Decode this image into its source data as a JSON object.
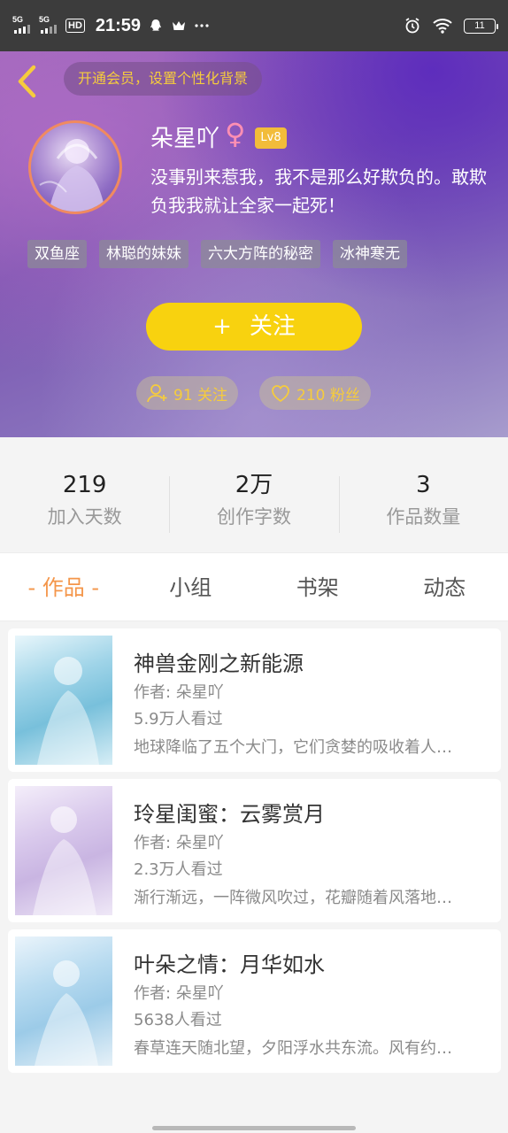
{
  "status_bar": {
    "signal1": "5G",
    "signal2": "5G",
    "hd": "HD",
    "time": "21:59",
    "battery": "11"
  },
  "header": {
    "vip_banner": "开通会员，设置个性化背景",
    "username": "朵星吖",
    "gender": "♀",
    "level": "Lv8",
    "bio": "没事别来惹我，我不是那么好欺负的。敢欺负我我就让全家一起死！",
    "tags": [
      "双鱼座",
      "林聪的妹妹",
      "六大方阵的秘密",
      "冰神寒无"
    ],
    "follow_button": "关注",
    "following": "91 关注",
    "followers": "210 粉丝"
  },
  "stats": [
    {
      "value": "219",
      "label": "加入天数"
    },
    {
      "value": "2万",
      "label": "创作字数"
    },
    {
      "value": "3",
      "label": "作品数量"
    }
  ],
  "tabs": [
    "- 作品 -",
    "小组",
    "书架",
    "动态"
  ],
  "books": [
    {
      "title": "神兽金刚之新能源",
      "author": "作者: 朵星吖",
      "views": "5.9万人看过",
      "desc": "地球降临了五个大门，它们贪婪的吸收着人…"
    },
    {
      "title": "玲星闺蜜：云雾赏月",
      "author": "作者: 朵星吖",
      "views": "2.3万人看过",
      "desc": "渐行渐远，一阵微风吹过，花瓣随着风落地…"
    },
    {
      "title": "叶朵之情：月华如水",
      "author": "作者: 朵星吖",
      "views": "5638人看过",
      "desc": "春草连天随北望，夕阳浮水共东流。风有约…"
    }
  ],
  "colors": {
    "accent_orange": "#f4964a",
    "follow_yellow": "#f8d20f",
    "vip_gold": "#f6cc3c",
    "header_purple": "#7a55b0"
  }
}
